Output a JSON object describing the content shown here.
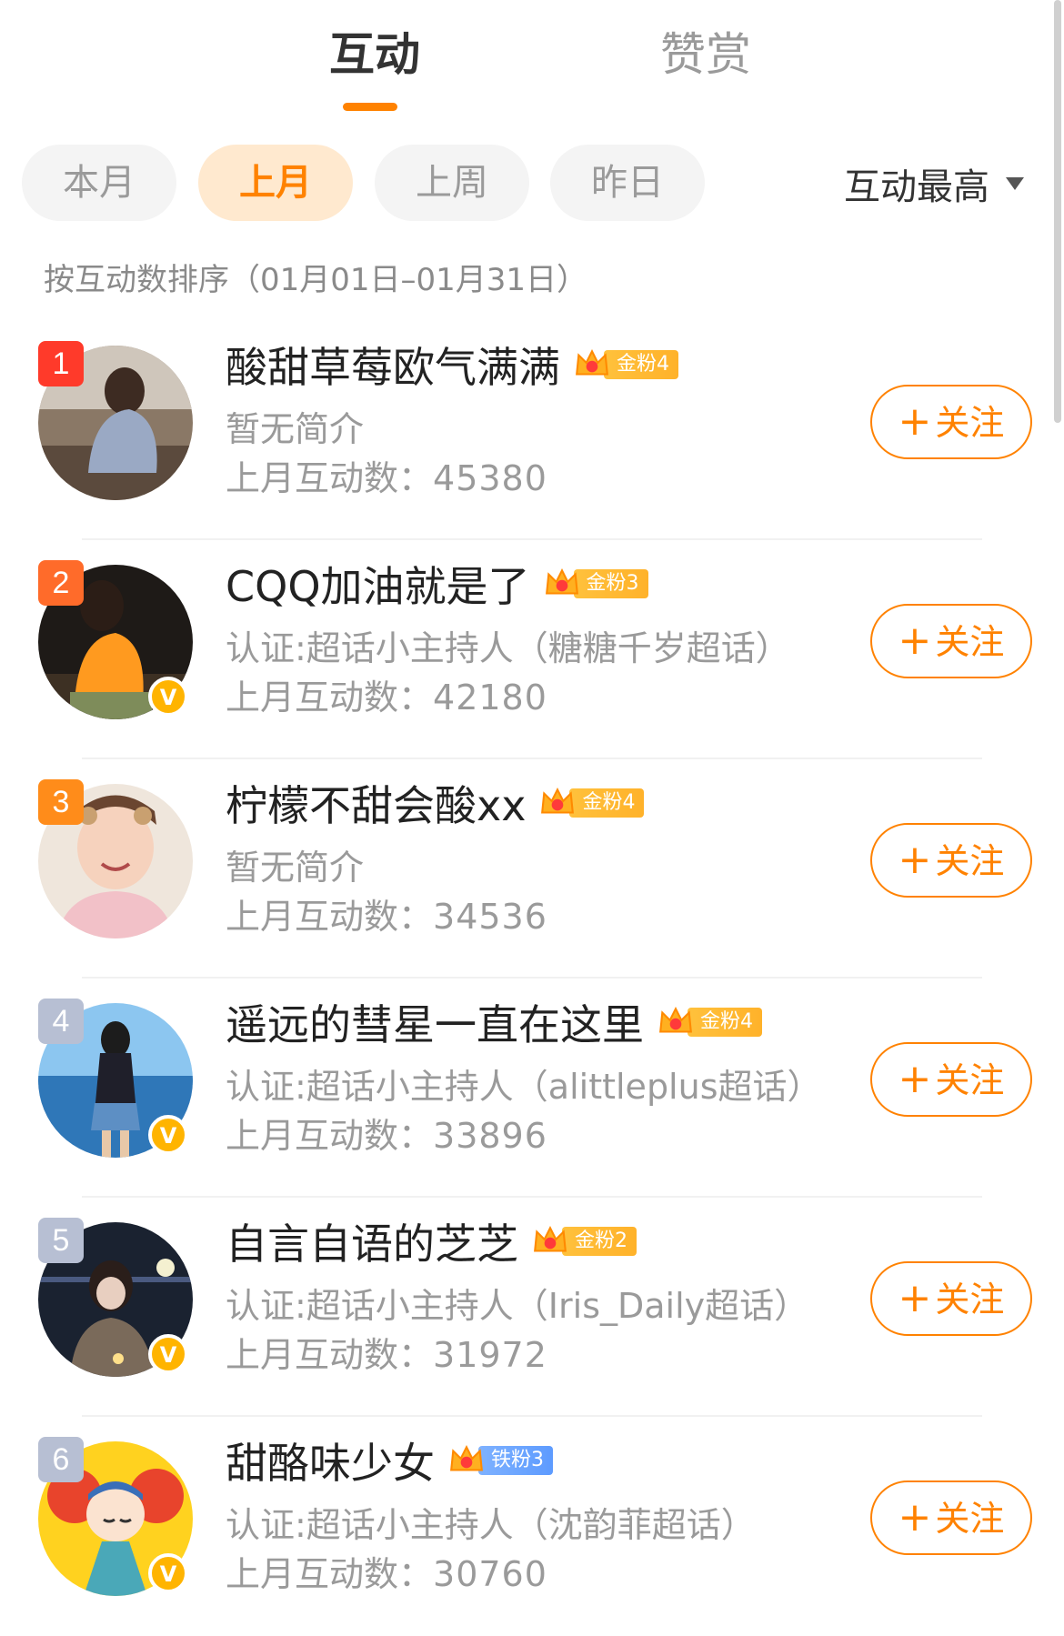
{
  "tabs": [
    {
      "label": "互动",
      "active": true
    },
    {
      "label": "赞赏",
      "active": false
    }
  ],
  "periods": [
    {
      "label": "本月",
      "active": false
    },
    {
      "label": "上月",
      "active": true
    },
    {
      "label": "上周",
      "active": false
    },
    {
      "label": "昨日",
      "active": false
    }
  ],
  "sort": {
    "label": "互动最高",
    "icon": "caret-down-icon"
  },
  "sort_note": "按互动数排序（01月01日–01月31日）",
  "count_label": "上月互动数：",
  "follow_label": "关注",
  "colors": {
    "accent": "#ff8200",
    "gold_badge": "#ffb22a",
    "iron_badge": "#5d9bff",
    "verified": "#ffb400"
  },
  "users": [
    {
      "rank": "1",
      "name": "酸甜草莓欧气满满",
      "badge": "金粉4",
      "badge_type": "gold",
      "desc": "暂无简介",
      "count": "45380",
      "verified": false
    },
    {
      "rank": "2",
      "name": "CQQ加油就是了",
      "badge": "金粉3",
      "badge_type": "gold",
      "desc": "认证:超话小主持人（糖糖千岁超话）",
      "count": "42180",
      "verified": true
    },
    {
      "rank": "3",
      "name": "柠檬不甜会酸xx",
      "badge": "金粉4",
      "badge_type": "gold",
      "desc": "暂无简介",
      "count": "34536",
      "verified": false
    },
    {
      "rank": "4",
      "name": "遥远的彗星一直在这里",
      "badge": "金粉4",
      "badge_type": "gold",
      "desc": "认证:超话小主持人（alittleplus超话）",
      "count": "33896",
      "verified": true
    },
    {
      "rank": "5",
      "name": "自言自语的芝芝",
      "badge": "金粉2",
      "badge_type": "gold",
      "desc": "认证:超话小主持人（Iris_Daily超话）",
      "count": "31972",
      "verified": true
    },
    {
      "rank": "6",
      "name": "甜酪味少女",
      "badge": "铁粉3",
      "badge_type": "iron",
      "desc": "认证:超话小主持人（沈韵菲超话）",
      "count": "30760",
      "verified": true
    }
  ]
}
